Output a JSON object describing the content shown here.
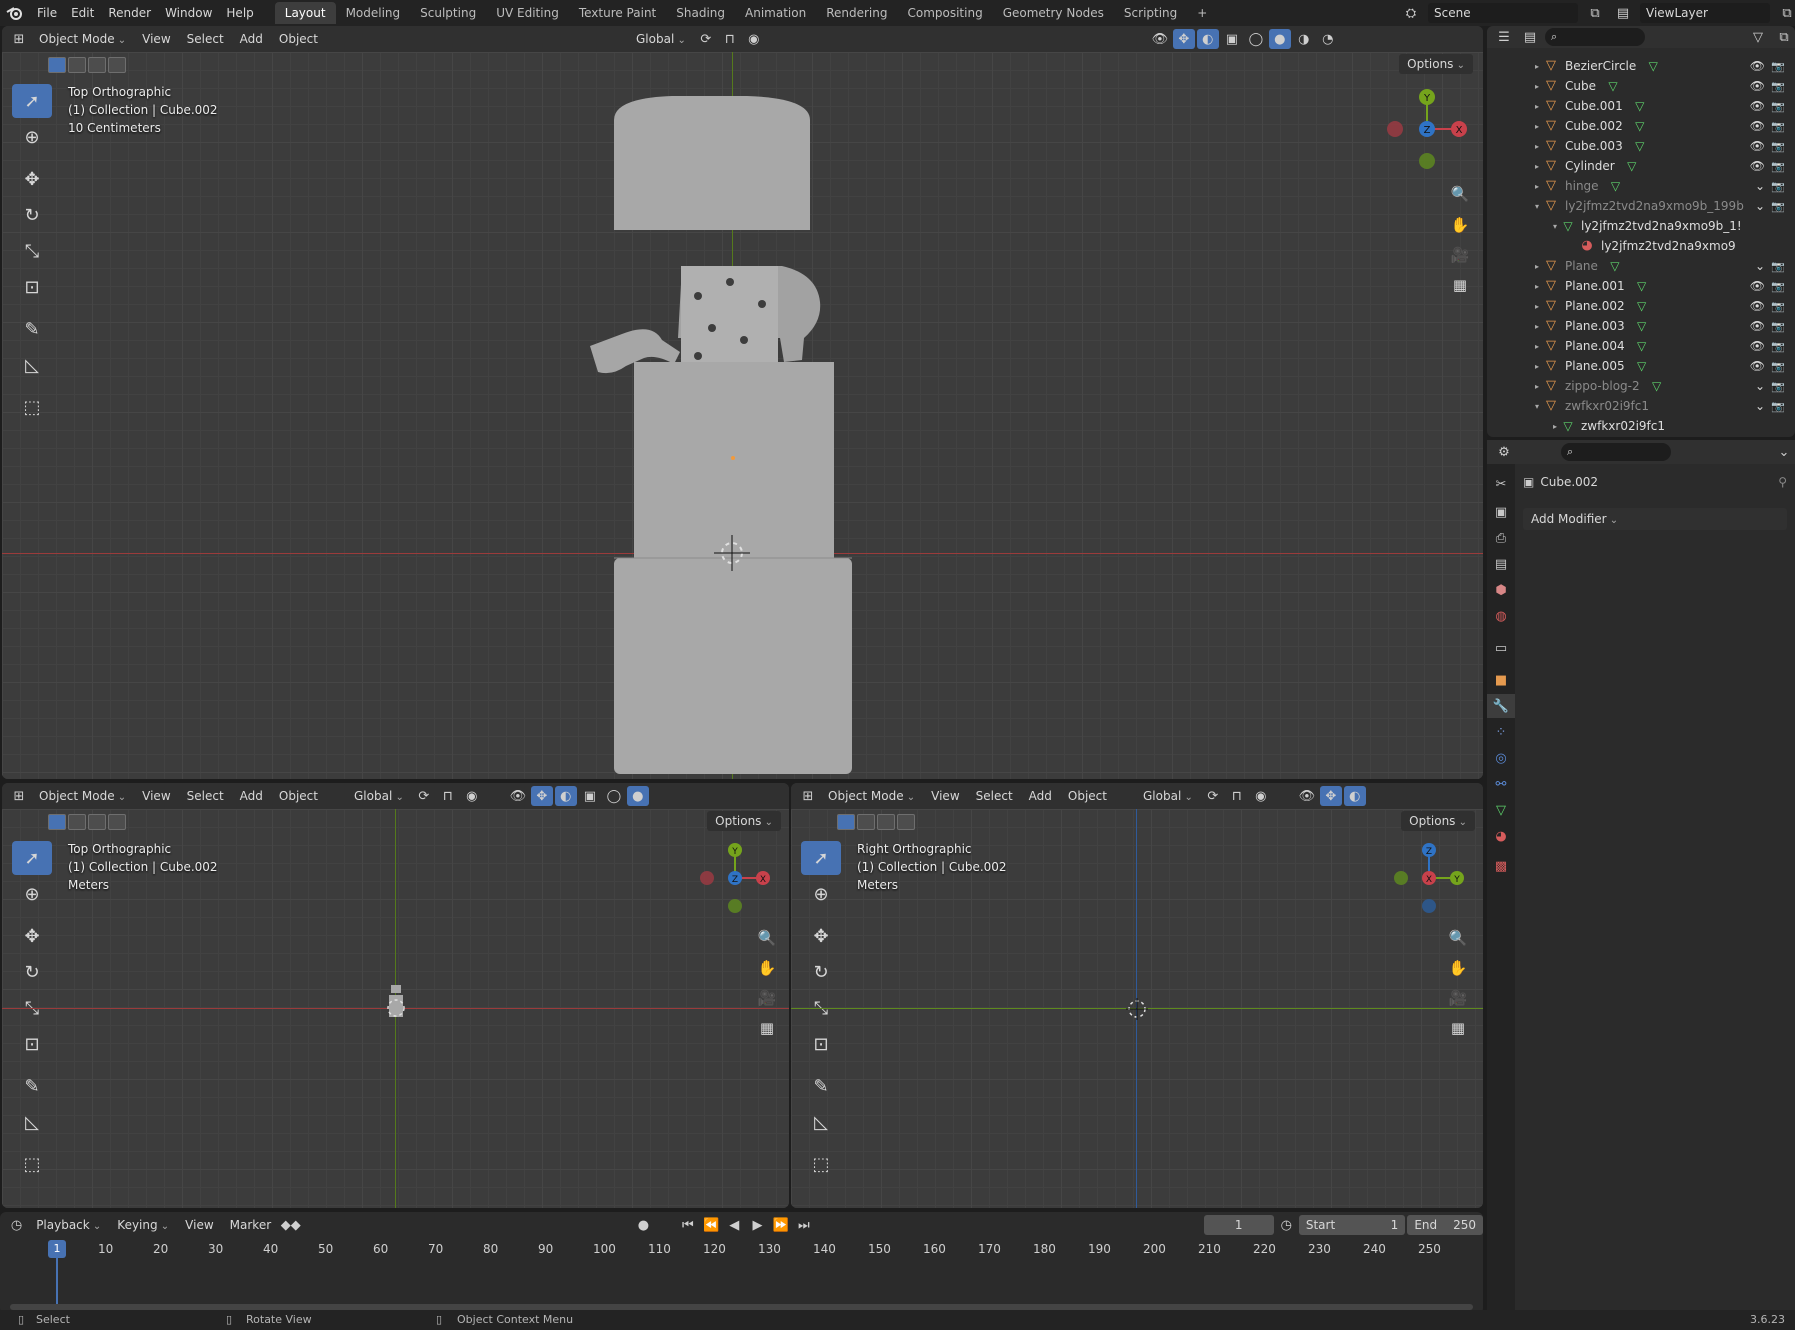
{
  "topbar": {
    "menus": [
      "File",
      "Edit",
      "Render",
      "Window",
      "Help"
    ],
    "workspaces": [
      "Layout",
      "Modeling",
      "Sculpting",
      "UV Editing",
      "Texture Paint",
      "Shading",
      "Animation",
      "Rendering",
      "Compositing",
      "Geometry Nodes",
      "Scripting"
    ],
    "active_workspace": "Layout",
    "add_workspace": "+",
    "scene": "Scene",
    "view_layer": "ViewLayer"
  },
  "viewport_header": {
    "mode": "Object Mode",
    "menus": [
      "View",
      "Select",
      "Add",
      "Object"
    ],
    "orientation": "Global",
    "options": "Options"
  },
  "viewport_main": {
    "view": "Top Orthographic",
    "collection": "(1) Collection | Cube.002",
    "scale": "10 Centimeters"
  },
  "viewport_left": {
    "view": "Top Orthographic",
    "collection": "(1) Collection | Cube.002",
    "scale": "Meters"
  },
  "viewport_right": {
    "view": "Right Orthographic",
    "collection": "(1) Collection | Cube.002",
    "scale": "Meters"
  },
  "gizmo_labels": {
    "x": "X",
    "y": "Y",
    "z": "Z"
  },
  "outliner": {
    "items": [
      {
        "name": "BezierCircle",
        "dim": false,
        "selected": false
      },
      {
        "name": "Cube",
        "dim": false,
        "selected": false
      },
      {
        "name": "Cube.001",
        "dim": false,
        "selected": false
      },
      {
        "name": "Cube.002",
        "dim": false,
        "selected": false
      },
      {
        "name": "Cube.003",
        "dim": false,
        "selected": false
      },
      {
        "name": "Cylinder",
        "dim": false,
        "selected": false
      },
      {
        "name": "hinge",
        "dim": true,
        "selected": false
      },
      {
        "name": "ly2jfmz2tvd2na9xmo9b_199b",
        "dim": true,
        "selected": false
      },
      {
        "name": "ly2jfmz2tvd2na9xmo9b_1!",
        "dim": false,
        "selected": false
      },
      {
        "name": "ly2jfmz2tvd2na9xmo9",
        "dim": false,
        "selected": false
      },
      {
        "name": "Plane",
        "dim": true,
        "selected": false
      },
      {
        "name": "Plane.001",
        "dim": false,
        "selected": false
      },
      {
        "name": "Plane.002",
        "dim": false,
        "selected": false
      },
      {
        "name": "Plane.003",
        "dim": false,
        "selected": false
      },
      {
        "name": "Plane.004",
        "dim": false,
        "selected": false
      },
      {
        "name": "Plane.005",
        "dim": false,
        "selected": false
      },
      {
        "name": "zippo-blog-2",
        "dim": true,
        "selected": false
      },
      {
        "name": "zwfkxr02i9fc1",
        "dim": true,
        "selected": false
      },
      {
        "name": "zwfkxr02i9fc1",
        "dim": false,
        "selected": false
      }
    ]
  },
  "properties": {
    "object_name": "Cube.002",
    "add_modifier": "Add Modifier"
  },
  "timeline": {
    "menus": [
      "Playback",
      "Keying",
      "View",
      "Marker"
    ],
    "current_frame": "1",
    "start_label": "Start",
    "start_value": "1",
    "end_label": "End",
    "end_value": "250",
    "ruler": [
      "10",
      "20",
      "30",
      "40",
      "50",
      "60",
      "70",
      "80",
      "90",
      "100",
      "110",
      "120",
      "130",
      "140",
      "150",
      "160",
      "170",
      "180",
      "190",
      "200",
      "210",
      "220",
      "230",
      "240",
      "250"
    ],
    "cursor_frame": "1"
  },
  "statusbar": {
    "select": "Select",
    "rotate": "Rotate View",
    "context": "Object Context Menu",
    "version": "3.6.23"
  },
  "colors": {
    "accent": "#4772b3",
    "x_axis": "#c8414b",
    "y_axis": "#75a41c",
    "z_axis": "#2f73c5",
    "object_icon": "#e59a4f",
    "mesh_icon": "#5dd36b"
  }
}
